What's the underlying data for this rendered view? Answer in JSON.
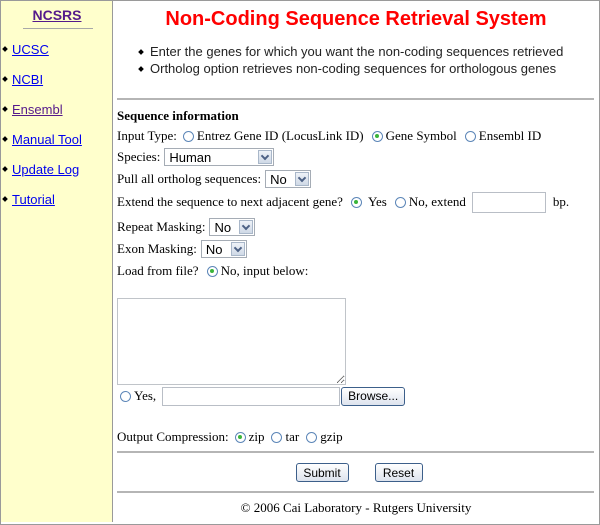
{
  "sidebar": {
    "brand": "NCSRS",
    "links": [
      {
        "label": "UCSC",
        "visited": false
      },
      {
        "label": "NCBI",
        "visited": false
      },
      {
        "label": "Ensembl",
        "visited": true
      },
      {
        "label": "Manual Tool",
        "visited": false
      },
      {
        "label": "Update Log",
        "visited": false
      },
      {
        "label": "Tutorial",
        "visited": false
      }
    ]
  },
  "header": {
    "title": "Non-Coding Sequence Retrieval System",
    "title_color": "#ff0000",
    "intro": [
      "Enter the genes for which you want the non-coding sequences retrieved",
      "Ortholog option retrieves non-coding sequences for orthologous genes"
    ]
  },
  "form": {
    "section_title": "Sequence information",
    "input_type": {
      "label": "Input Type:",
      "options": [
        {
          "label": "Entrez Gene ID (LocusLink ID)",
          "checked": false
        },
        {
          "label": "Gene Symbol",
          "checked": true
        },
        {
          "label": "Ensembl ID",
          "checked": false
        }
      ]
    },
    "species": {
      "label": "Species:",
      "value": "Human"
    },
    "ortholog": {
      "label": "Pull all ortholog sequences:",
      "value": "No"
    },
    "extend": {
      "label": "Extend the sequence to next adjacent gene?",
      "yes_label": "Yes",
      "yes_checked": true,
      "no_label": "No, extend",
      "no_checked": false,
      "bp_value": "",
      "unit": "bp."
    },
    "repeat_masking": {
      "label": "Repeat Masking:",
      "value": "No"
    },
    "exon_masking": {
      "label": "Exon Masking:",
      "value": "No"
    },
    "load_from_file": {
      "label": "Load from file?",
      "no_label": "No, input below:",
      "no_checked": true,
      "sequence_text": "",
      "yes_label": "Yes,",
      "yes_checked": false,
      "file_path": "",
      "browse_label": "Browse..."
    },
    "output_compression": {
      "label": "Output Compression:",
      "options": [
        {
          "label": "zip",
          "checked": true
        },
        {
          "label": "tar",
          "checked": false
        },
        {
          "label": "gzip",
          "checked": false
        }
      ]
    },
    "submit_label": "Submit",
    "reset_label": "Reset"
  },
  "footer": {
    "text": "© 2006 Cai Laboratory - Rutgers University"
  }
}
